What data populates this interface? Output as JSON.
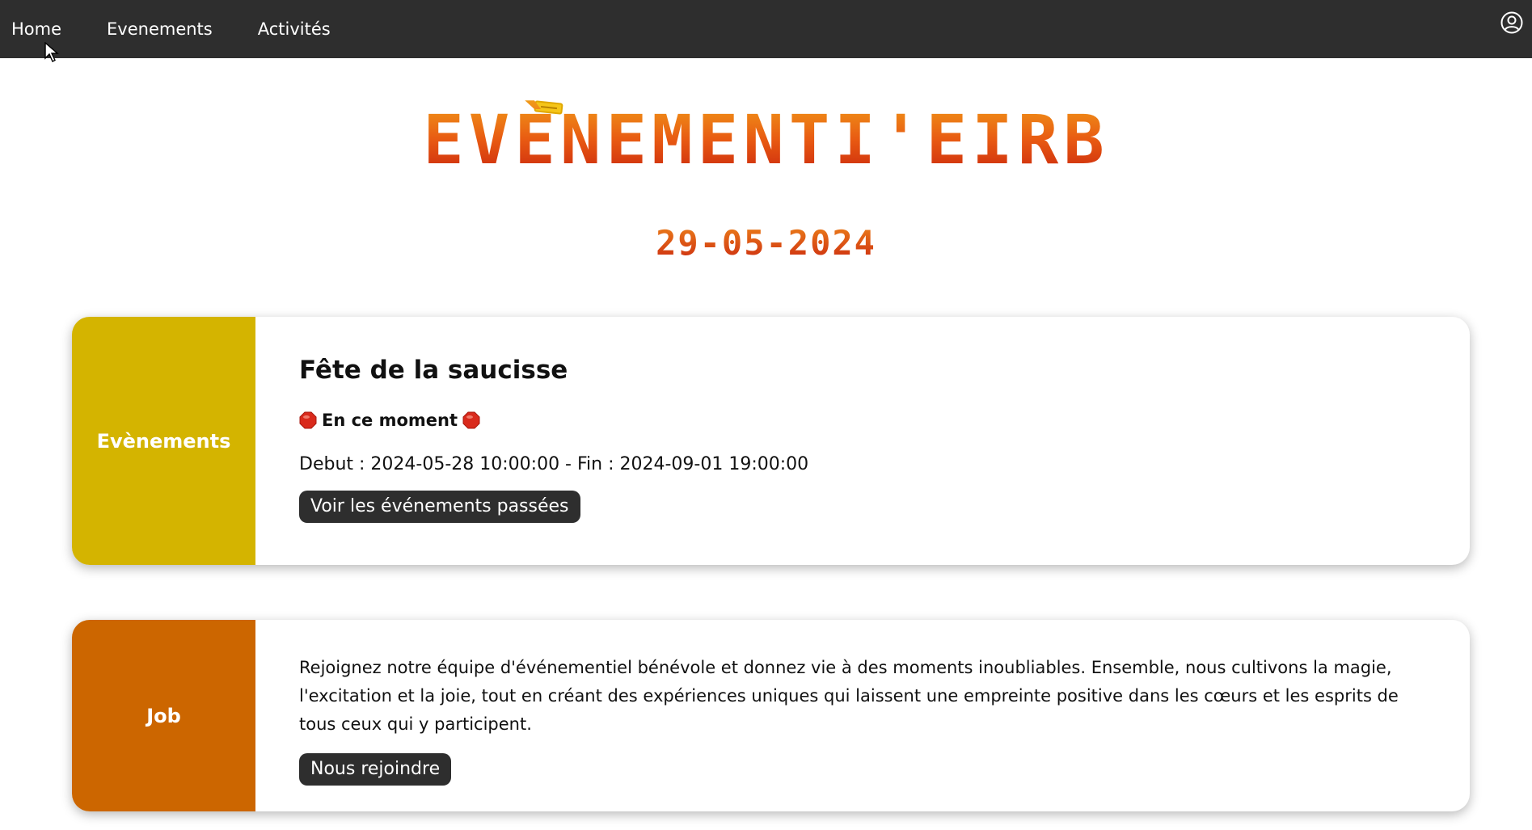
{
  "nav": {
    "items": [
      {
        "label": "Home"
      },
      {
        "label": "Evenements"
      },
      {
        "label": "Activités"
      }
    ],
    "user_icon": "user-circle-icon"
  },
  "hero": {
    "title": "EVÈNEMENTI'EIRB",
    "date": "29-05-2024"
  },
  "events_card": {
    "side_label": "Evènements",
    "title": "Fête de la saucisse",
    "status_icon": "stop-sign-icon",
    "status_text": "En ce moment",
    "dates": "Debut : 2024-05-28 10:00:00 - Fin : 2024-09-01 19:00:00",
    "button_label": "Voir les événements passées",
    "accent_color": "#d4b400"
  },
  "job_card": {
    "side_label": "Job",
    "text": "Rejoignez notre équipe d'événementiel bénévole et donnez vie à des moments inoubliables. Ensemble, nous cultivons la magie, l'excitation et la joie, tout en créant des expériences uniques qui laissent une empreinte positive dans les cœurs et les esprits de tous ceux qui y participent.",
    "button_label": "Nous rejoindre",
    "accent_color": "#cc6600"
  },
  "colors": {
    "navbar": "#2e2e2e",
    "title_gradient_top": "#f2a21a",
    "title_gradient_bottom": "#c41c0c"
  }
}
